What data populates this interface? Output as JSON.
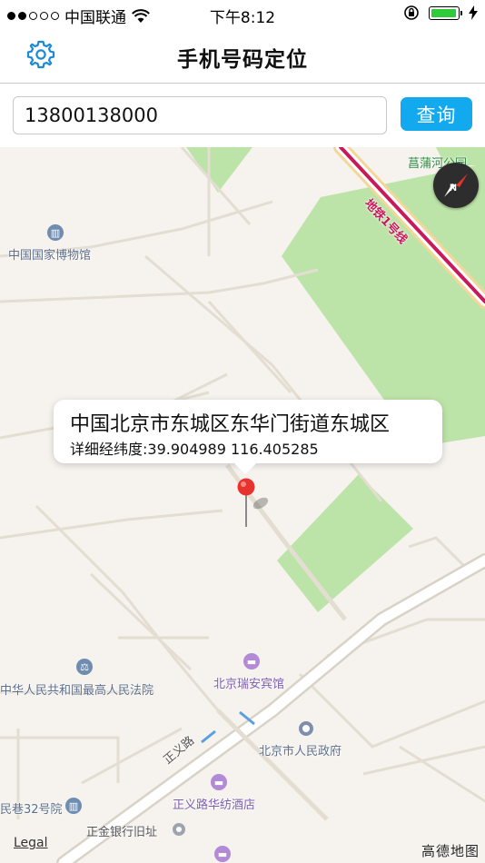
{
  "status_bar": {
    "carrier": "中国联通",
    "time": "下午8:12",
    "battery_level": 0.95
  },
  "nav": {
    "title": "手机号码定位",
    "settings_icon": "gear-icon"
  },
  "search": {
    "phone_value": "13800138000",
    "query_label": "查询"
  },
  "map": {
    "labels": {
      "museum": "中国国家博物馆",
      "subway": "地铁1号线",
      "park": "菖蒲河公园",
      "court": "中华人民共和国最高人民法院",
      "hotel_ruian": "北京瑞安宾馆",
      "road_zhengyi": "正义路",
      "gov": "北京市人民政府",
      "hotel_huafang": "正义路华纺酒店",
      "alley": "民巷32号院",
      "bank_site": "正金银行旧址"
    },
    "callout": {
      "title": "中国北京市东城区东华门街道东城区",
      "detail": "详细经纬度:39.904989 116.405285"
    },
    "legal": "Legal",
    "logo": "高德地图"
  },
  "colors": {
    "accent": "#13a9ee",
    "settings_icon": "#1a8ad6",
    "park_green": "#bde4a8",
    "map_bg": "#f6f3ee",
    "pin_red": "#e8322d"
  }
}
